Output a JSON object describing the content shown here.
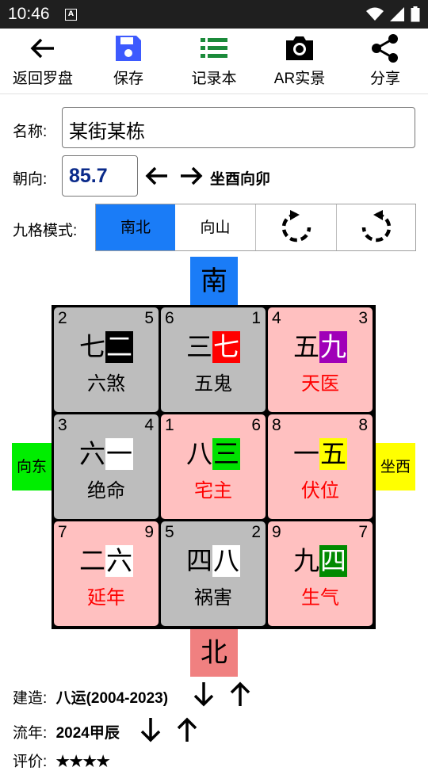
{
  "status_bar": {
    "time": "10:46",
    "app_icon": "A"
  },
  "toolbar": {
    "items": [
      {
        "label": "返回罗盘",
        "icon": "arrow-left-icon"
      },
      {
        "label": "保存",
        "icon": "save-icon"
      },
      {
        "label": "记录本",
        "icon": "list-icon"
      },
      {
        "label": "AR实景",
        "icon": "camera-icon"
      },
      {
        "label": "分享",
        "icon": "share-icon"
      }
    ]
  },
  "form": {
    "name_label": "名称:",
    "name_value": "某街某栋",
    "direction_label": "朝向:",
    "direction_value": "85.7",
    "facing_text": "坐酉向卯",
    "mode_label": "九格模式:",
    "modes": [
      "南北",
      "向山"
    ],
    "active_mode": "南北"
  },
  "compass": {
    "top": "南",
    "bottom": "北",
    "left": "向东",
    "right": "坐西"
  },
  "grid": {
    "cells": [
      {
        "tl": "2",
        "tr": "5",
        "main": "七",
        "star": "二",
        "star_bg": "#000000",
        "star_fg": "#ffffff",
        "name": "六煞",
        "name_color": "#000000",
        "bg": "#bdbdbd"
      },
      {
        "tl": "6",
        "tr": "1",
        "main": "三",
        "star": "七",
        "star_bg": "#ff0000",
        "star_fg": "#ffffff",
        "name": "五鬼",
        "name_color": "#000000",
        "bg": "#bdbdbd"
      },
      {
        "tl": "4",
        "tr": "3",
        "main": "五",
        "star": "九",
        "star_bg": "#a000b8",
        "star_fg": "#ffffff",
        "name": "天医",
        "name_color": "#ff0000",
        "bg": "#ffc0c0"
      },
      {
        "tl": "3",
        "tr": "4",
        "main": "六",
        "star": "一",
        "star_bg": "#ffffff",
        "star_fg": "#000000",
        "name": "绝命",
        "name_color": "#000000",
        "bg": "#bdbdbd"
      },
      {
        "tl": "1",
        "tr": "6",
        "main": "八",
        "star": "三",
        "star_bg": "#00e000",
        "star_fg": "#000000",
        "name": "宅主",
        "name_color": "#ff0000",
        "bg": "#ffc0c0"
      },
      {
        "tl": "8",
        "tr": "8",
        "main": "一",
        "star": "五",
        "star_bg": "#ffff00",
        "star_fg": "#000000",
        "name": "伏位",
        "name_color": "#ff0000",
        "bg": "#ffc0c0"
      },
      {
        "tl": "7",
        "tr": "9",
        "main": "二",
        "star": "六",
        "star_bg": "#ffffff",
        "star_fg": "#000000",
        "name": "延年",
        "name_color": "#ff0000",
        "bg": "#ffc0c0"
      },
      {
        "tl": "5",
        "tr": "2",
        "main": "四",
        "star": "八",
        "star_bg": "#ffffff",
        "star_fg": "#000000",
        "name": "祸害",
        "name_color": "#000000",
        "bg": "#bdbdbd"
      },
      {
        "tl": "9",
        "tr": "7",
        "main": "九",
        "star": "四",
        "star_bg": "#008a00",
        "star_fg": "#ffffff",
        "name": "生气",
        "name_color": "#ff0000",
        "bg": "#ffc0c0"
      }
    ]
  },
  "info": {
    "build_label": "建造:",
    "build_value": "八运(2004-2023)",
    "year_label": "流年:",
    "year_value": "2024甲辰",
    "rating_label": "评价:",
    "rating_value": "★★★★"
  },
  "colors": {
    "accent_blue": "#1a7cf7",
    "south_bg": "#1a7cf7",
    "north_bg": "#f08080",
    "east_bg": "#00ee00",
    "west_bg": "#ffff00"
  }
}
